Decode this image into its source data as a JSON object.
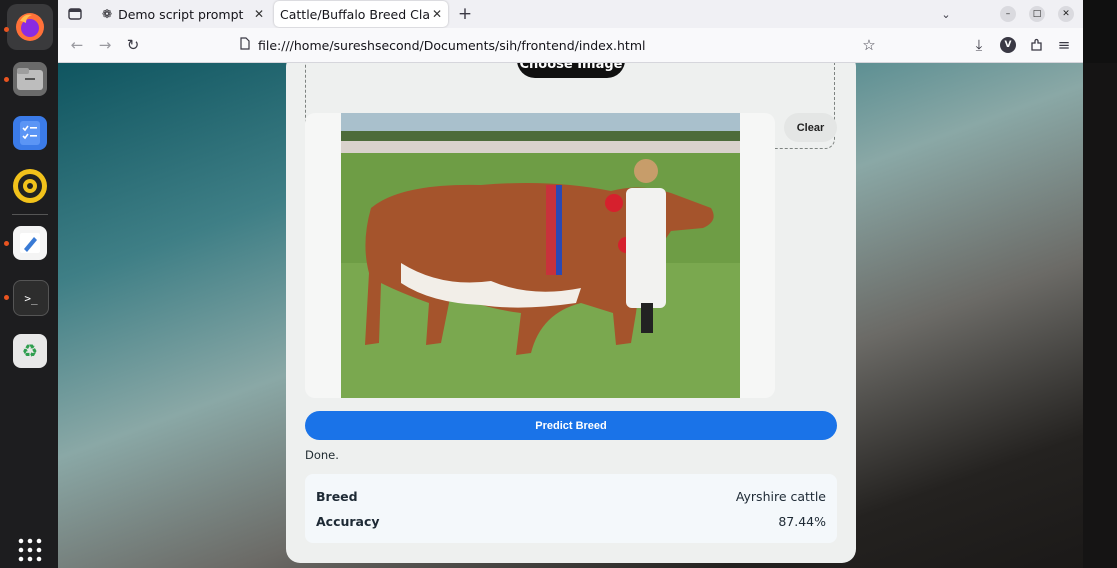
{
  "browser": {
    "tabs": [
      {
        "label": "Demo script prompt",
        "active": false
      },
      {
        "label": "Cattle/Buffalo Breed Classifi",
        "active": true
      }
    ],
    "url": "file:///home/sureshsecond/Documents/sih/frontend/index.html",
    "account_badge": "V"
  },
  "page": {
    "choose_image_label": "Choose Image",
    "clear_label": "Clear",
    "predict_label": "Predict Breed",
    "status_text": "Done.",
    "results": [
      {
        "key": "Breed",
        "value": "Ayrshire cattle"
      },
      {
        "key": "Accuracy",
        "value": "87.44%"
      }
    ]
  },
  "colors": {
    "predict_button": "#1a73e8",
    "dock_accent": "#e95420"
  },
  "dock_icons": [
    "firefox-icon",
    "files-icon",
    "tasks-icon",
    "rhythmbox-icon",
    "text-editor-icon",
    "terminal-icon",
    "trash-icon",
    "app-grid-icon"
  ]
}
